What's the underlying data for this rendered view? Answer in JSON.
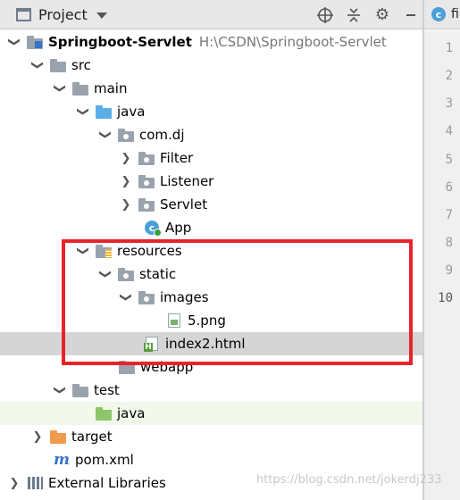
{
  "header": {
    "title": "Project",
    "icons": [
      "globe-target-icon",
      "collapse-icon",
      "gear-icon",
      "minimize-icon"
    ]
  },
  "editor": {
    "tab_label": "fi",
    "tab_badge": "c",
    "line_numbers": [
      "1",
      "2",
      "3",
      "4",
      "5",
      "6",
      "7",
      "8",
      "9",
      "10"
    ]
  },
  "tree": [
    {
      "label": "Springboot-Servlet",
      "path": "H:\\CSDN\\Springboot-Servlet",
      "icon": "module-folder-icon",
      "expanded": true,
      "bold": true
    },
    {
      "label": "src",
      "icon": "folder-icon",
      "expanded": true
    },
    {
      "label": "main",
      "icon": "folder-icon",
      "expanded": true
    },
    {
      "label": "java",
      "icon": "source-folder-icon",
      "expanded": true
    },
    {
      "label": "com.dj",
      "icon": "package-icon",
      "expanded": true
    },
    {
      "label": "Filter",
      "icon": "package-icon",
      "expanded": false
    },
    {
      "label": "Listener",
      "icon": "package-icon",
      "expanded": false
    },
    {
      "label": "Servlet",
      "icon": "package-icon",
      "expanded": false
    },
    {
      "label": "App",
      "icon": "spring-class-icon",
      "expanded": null
    },
    {
      "label": "resources",
      "icon": "resources-folder-icon",
      "expanded": true
    },
    {
      "label": "static",
      "icon": "package-icon",
      "expanded": true
    },
    {
      "label": "images",
      "icon": "package-icon",
      "expanded": true
    },
    {
      "label": "5.png",
      "icon": "image-file-icon",
      "expanded": null
    },
    {
      "label": "index2.html",
      "icon": "html-file-icon",
      "expanded": null,
      "selected": true
    },
    {
      "label": "webapp",
      "icon": "folder-icon",
      "expanded": null
    },
    {
      "label": "test",
      "icon": "folder-icon",
      "expanded": true
    },
    {
      "label": "java",
      "icon": "test-folder-icon",
      "expanded": null
    },
    {
      "label": "target",
      "icon": "excluded-folder-icon",
      "expanded": false
    },
    {
      "label": "pom.xml",
      "icon": "maven-icon",
      "expanded": null
    },
    {
      "label": "External Libraries",
      "icon": "libraries-icon",
      "expanded": false
    }
  ],
  "watermark": "https://blog.csdn.net/jokerdj233",
  "colors": {
    "selection": "#d5d5d5",
    "highlight_box": "#e8232b",
    "source_folder": "#5aaee6",
    "test_folder": "#8cc56a",
    "excluded_folder": "#f09a4e"
  }
}
